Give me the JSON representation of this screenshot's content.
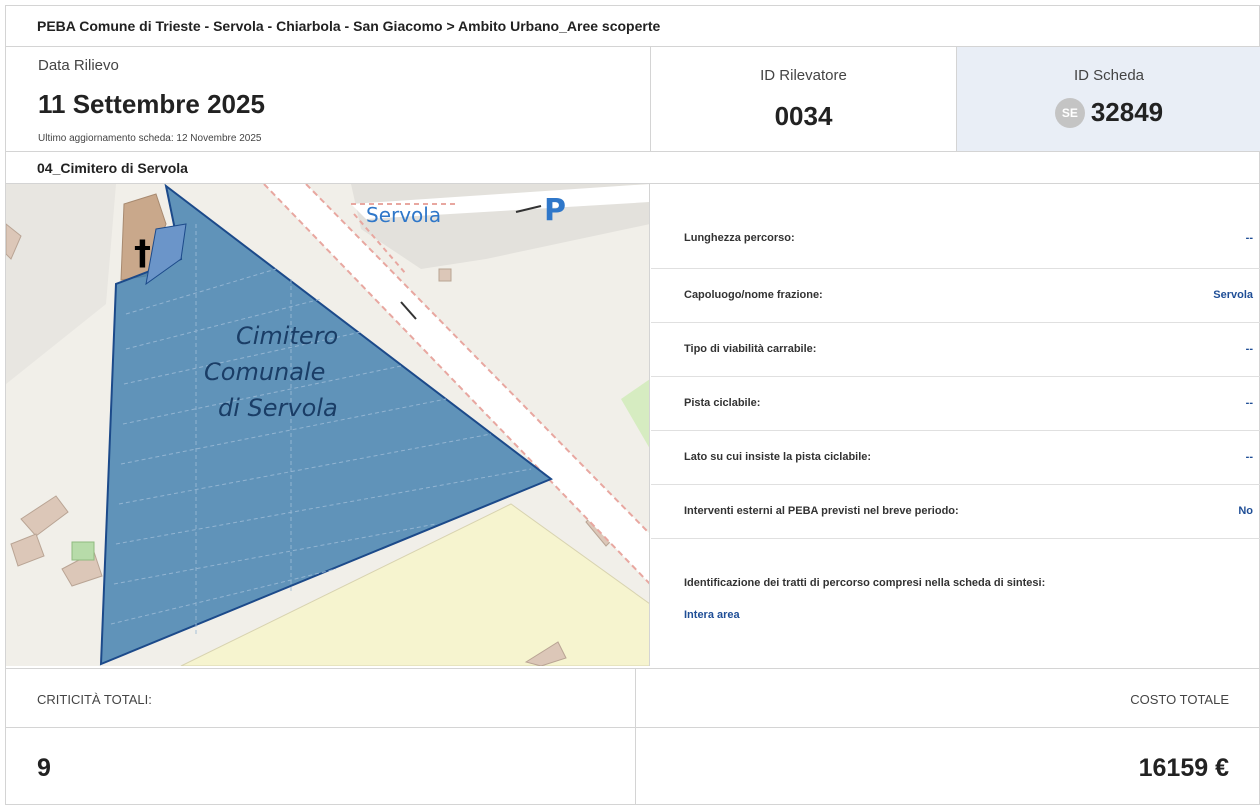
{
  "header": {
    "breadcrumb": "PEBA Comune di Trieste - Servola - Chiarbola - San Giacomo > Ambito Urbano_Aree scoperte"
  },
  "survey": {
    "date_label": "Data Rilievo",
    "date_value": "11 Settembre 2025",
    "last_update": "Ultimo aggiornamento scheda: 12 Novembre 2025",
    "surveyor_label": "ID Rilevatore",
    "surveyor_value": "0034",
    "sheet_label": "ID Scheda",
    "sheet_badge": "SE",
    "sheet_value": "32849"
  },
  "section": {
    "title": "04_Cimitero di Servola"
  },
  "map": {
    "place_label": "Servola",
    "parking_label": "P",
    "area_label_1": "Cimitero",
    "area_label_2": "Comunale",
    "area_label_3": "di Servola",
    "area_color": "#3f7fae"
  },
  "properties": [
    {
      "label": "Lunghezza percorso:",
      "value": "--"
    },
    {
      "label": "Capoluogo/nome frazione:",
      "value": "Servola"
    },
    {
      "label": "Tipo di viabilità carrabile:",
      "value": "--"
    },
    {
      "label": "Pista ciclabile:",
      "value": "--"
    },
    {
      "label": "Lato su cui insiste la pista ciclabile:",
      "value": "--"
    },
    {
      "label": "Interventi esterni al PEBA previsti nel breve periodo:",
      "value": "No"
    },
    {
      "label": "Identificazione dei tratti di percorso compresi nella scheda di sintesi:",
      "value": "Intera area"
    }
  ],
  "totals": {
    "criticita_label": "CRITICITÀ TOTALI:",
    "criticita_value": "9",
    "costo_label": "COSTO TOTALE",
    "costo_value": "16159 €"
  },
  "colors": {
    "accent": "#1f4e96",
    "sheet_bg": "#e9eef6"
  }
}
